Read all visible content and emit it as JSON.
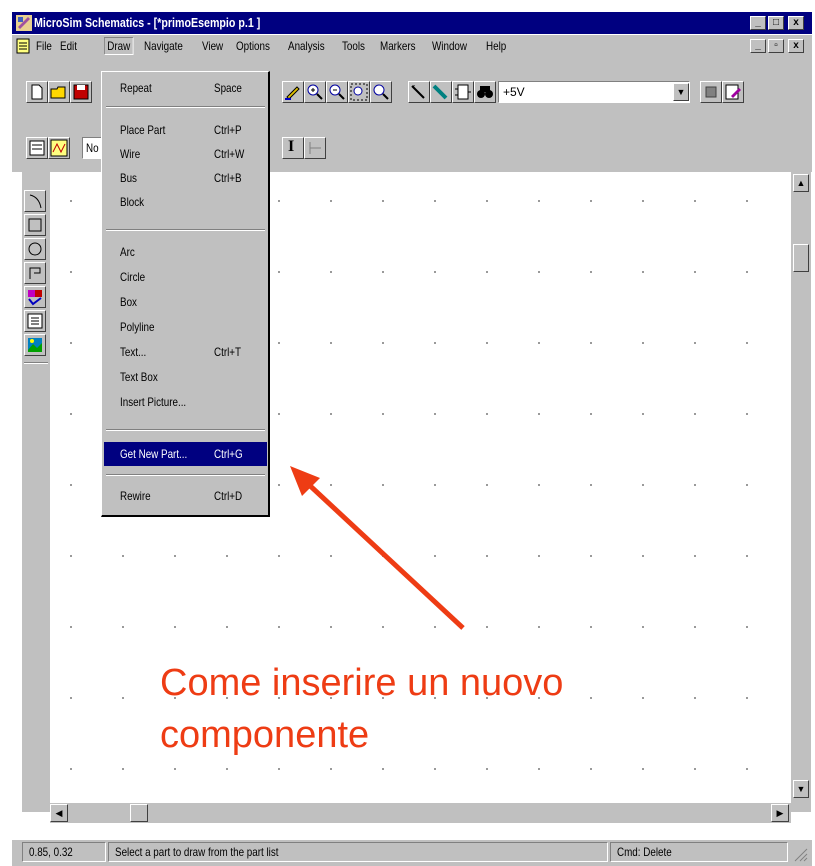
{
  "window": {
    "title": "MicroSim Schematics - [*primoEsempio  p.1  ]",
    "caption_buttons": [
      "_",
      "□",
      "x"
    ],
    "mdi_buttons": [
      "_",
      "▫",
      "x"
    ]
  },
  "menubar": {
    "items": [
      "File",
      "Edit",
      "Draw",
      "Navigate",
      "View",
      "Options",
      "Analysis",
      "Tools",
      "Markers",
      "Window",
      "Help"
    ],
    "active": "Draw"
  },
  "toolbar": {
    "part_combo_value": "+5V",
    "second_combo_value": "No"
  },
  "draw_menu": {
    "items": [
      {
        "label": "Repeat",
        "shortcut": "Space"
      },
      {
        "label": "Place Part",
        "shortcut": "Ctrl+P"
      },
      {
        "label": "Wire",
        "shortcut": "Ctrl+W"
      },
      {
        "label": "Bus",
        "shortcut": "Ctrl+B"
      },
      {
        "label": "Block",
        "shortcut": ""
      },
      {
        "label": "Arc",
        "shortcut": ""
      },
      {
        "label": "Circle",
        "shortcut": ""
      },
      {
        "label": "Box",
        "shortcut": ""
      },
      {
        "label": "Polyline",
        "shortcut": ""
      },
      {
        "label": "Text...",
        "shortcut": "Ctrl+T"
      },
      {
        "label": "Text Box",
        "shortcut": ""
      },
      {
        "label": "Insert Picture...",
        "shortcut": ""
      },
      {
        "label": "Get New Part...",
        "shortcut": "Ctrl+G"
      },
      {
        "label": "Rewire",
        "shortcut": "Ctrl+D"
      }
    ],
    "selected": "Get New Part..."
  },
  "statusbar": {
    "coords": "0.85, 0.32",
    "message": "Select a part to draw from the part list",
    "cmd": "Cmd: Delete"
  },
  "annotation": {
    "caption_line1": "Come inserire un nuovo",
    "caption_line2": "componente",
    "color": "#ee3c14"
  }
}
